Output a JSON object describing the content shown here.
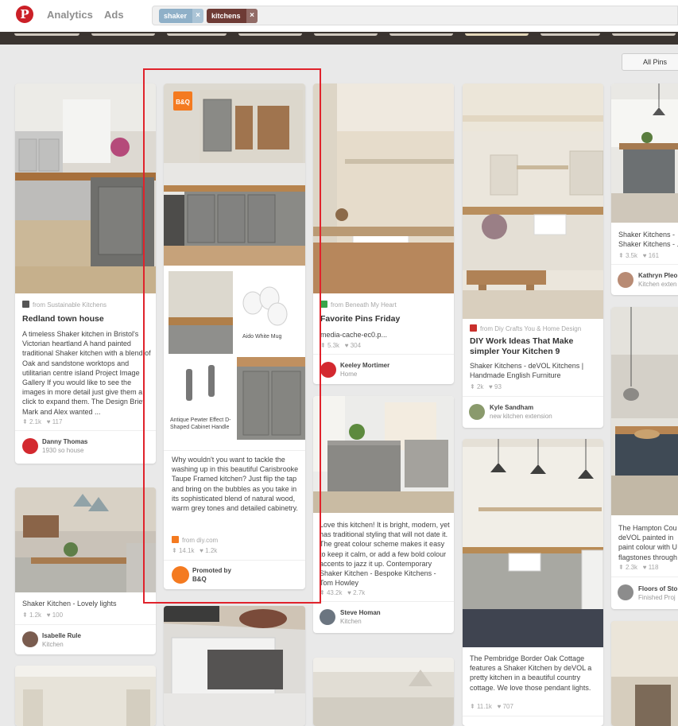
{
  "header": {
    "logo_glyph": "P",
    "nav": [
      "Analytics",
      "Ads"
    ],
    "tags": [
      {
        "label": "shaker",
        "color": "#8fb0c8"
      },
      {
        "label": "kitchens",
        "color": "#6e3b35"
      }
    ],
    "remove_glyph": "×"
  },
  "all_pins_label": "All Pins",
  "pins": [
    {
      "source": "from Sustainable Kitchens",
      "title": "Redland town house",
      "description": "A timeless Shaker kitchen in Bristol's Victorian heartland A hand painted traditional Shaker kitchen with a blend of Oak and sandstone worktops and utilitarian centre island Project Image Gallery If you would like to see the images in more detail just give them a click to expand them. The Design Brief Mark and Alex wanted ...",
      "repins": "2.1k",
      "likes": "117",
      "user": "Danny Thomas",
      "board": "1930 so house"
    },
    {
      "description": "Shaker Kitchen - Lovely lights",
      "repins": "1.2k",
      "likes": "100",
      "user": "Isabelle Rule",
      "board": "Kitchen"
    },
    {
      "collage": [
        "Aido White Mug",
        "Antique Pewter Effect D-Shaped Cabinet Handle"
      ],
      "description": "Why wouldn't you want to tackle the washing up in this beautiful Carisbrooke Taupe Framed kitchen? Just flip the tap and bring on the bubbles as you take in its sophisticated blend of natural wood, warm grey tones and detailed cabinetry.",
      "source": "from diy.com",
      "repins": "14.1k",
      "likes": "1.2k",
      "user": "Promoted by",
      "board": "B&Q"
    },
    {
      "source": "from Beneath My Heart",
      "title": "Favorite Pins Friday",
      "description": "media-cache-ec0.p...",
      "repins": "5.3k",
      "likes": "304",
      "user": "Keeley Mortimer",
      "board": "Home"
    },
    {
      "description": "Love this kitchen! It is bright, modern, yet has traditional styling that will not date it. The great colour scheme makes it easy to keep it calm, or add a few bold colour accents to jazz it up. Contemporary Shaker Kitchen - Bespoke Kitchens - Tom Howley",
      "repins": "43.2k",
      "likes": "2.7k",
      "user": "Steve Homan",
      "board": "Kitchen"
    },
    {
      "source": "from Diy Crafts You & Home Design",
      "title": "DIY Work Ideas That Make simpler Your Kitchen 9",
      "description": "Shaker Kitchens - deVOL Kitchens | Handmade English Furniture",
      "repins": "2k",
      "likes": "93",
      "user": "Kyle Sandham",
      "board": "new kitchen extension"
    },
    {
      "description": "The Pembridge Border Oak Cottage features a Shaker Kitchen by deVOL a pretty kitchen in a beautiful country cottage. We love those pendant lights.",
      "repins": "11.1k",
      "likes": "707"
    },
    {
      "description": "Shaker Kitchens - Shaker Kitchens - ...",
      "repins": "3.5k",
      "likes": "161",
      "user": "Kathryn Pleo",
      "board": "Kitchen exten"
    },
    {
      "description": "The Hampton Cou deVOL painted in paint colour with U flagstones through",
      "repins": "2.3k",
      "likes": "118",
      "user": "Floors of Sto",
      "board": "Finished Proj"
    }
  ]
}
